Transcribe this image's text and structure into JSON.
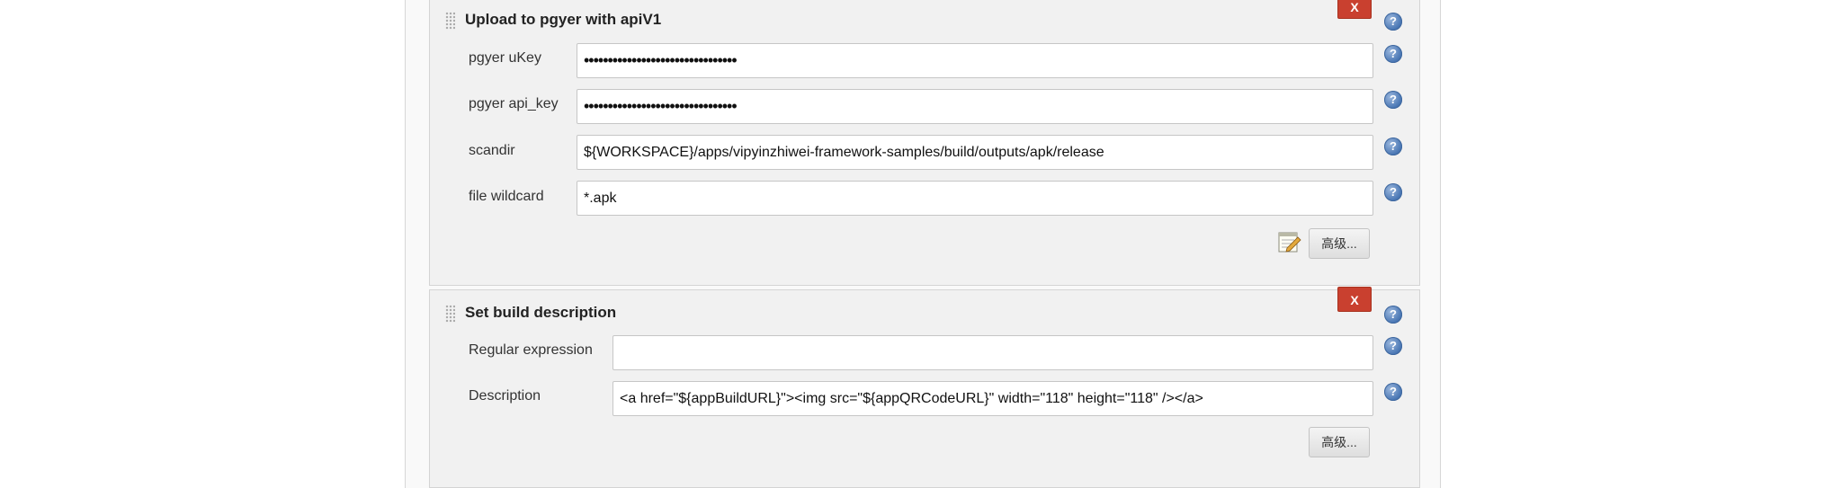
{
  "upload": {
    "title": "Upload to pgyer with apiV1",
    "delete_label": "X",
    "fields": [
      {
        "label": "pgyer uKey",
        "value": "••••••••••••••••••••••••••••••••"
      },
      {
        "label": "pgyer api_key",
        "value": "••••••••••••••••••••••••••••••••"
      },
      {
        "label": "scandir",
        "value": "${WORKSPACE}/apps/vipyinzhiwei-framework-samples/build/outputs/apk/release"
      },
      {
        "label": "file wildcard",
        "value": "*.apk"
      }
    ],
    "advanced_label": "高级..."
  },
  "description": {
    "title": "Set build description",
    "delete_label": "X",
    "fields": [
      {
        "label": "Regular expression",
        "value": ""
      },
      {
        "label": "Description",
        "value": "<a href=\"${appBuildURL}\"><img src=\"${appQRCodeURL}\" width=\"118\" height=\"118\" /></a>"
      }
    ],
    "advanced_label": "高级..."
  },
  "help_glyph": "?",
  "icons": {
    "help": "help-icon",
    "notepad": "notepad-icon",
    "drag": "drag-handle-icon"
  },
  "colors": {
    "delete_button": "#c9402f",
    "help_icon": "#4b78b5",
    "section_bg": "#f1f1f1"
  }
}
